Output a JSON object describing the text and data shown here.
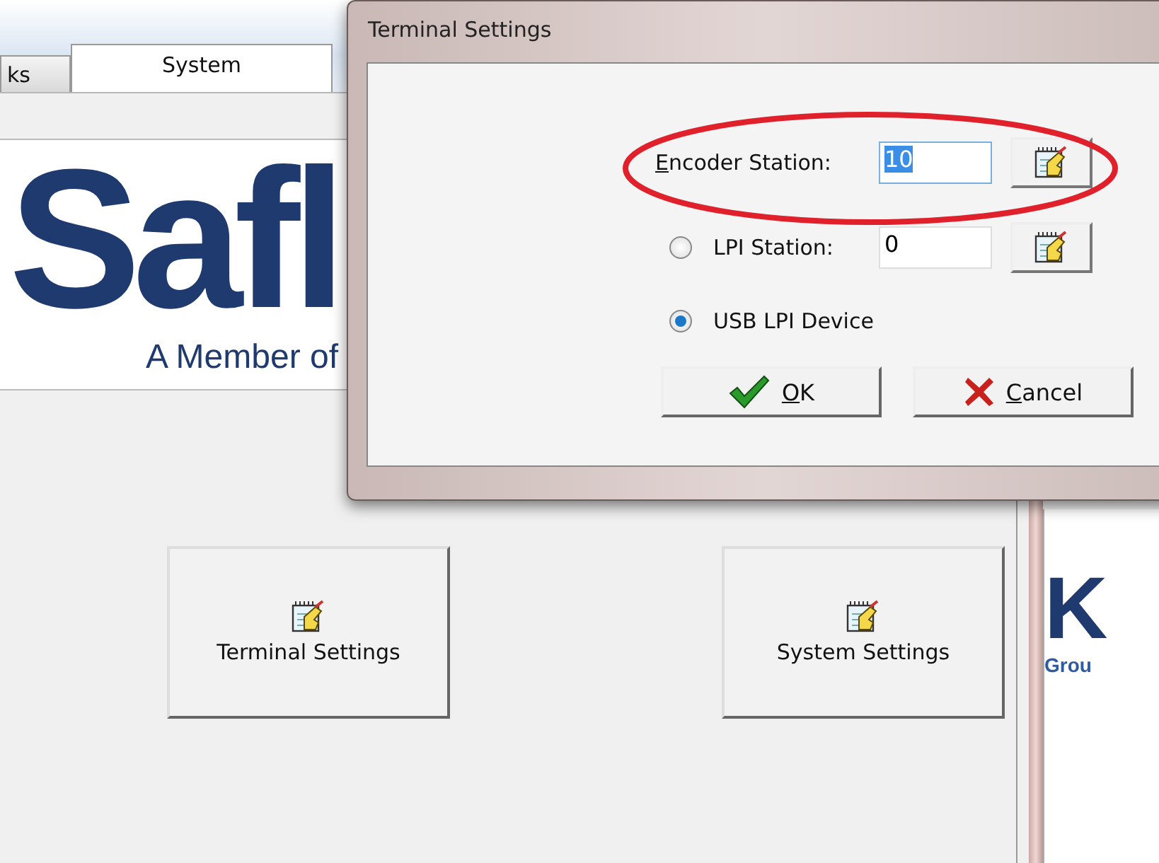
{
  "main_window": {
    "tabs": [
      {
        "label": "ks",
        "selected": false
      },
      {
        "label": "System",
        "selected": true
      }
    ],
    "logo": {
      "wordmark": "Safl",
      "tagline": "A Member of"
    },
    "buttons": [
      {
        "label": "Terminal Settings"
      },
      {
        "label": "System Settings"
      }
    ]
  },
  "back_window": {
    "wordmark": "K",
    "tagline": "Grou"
  },
  "dialog": {
    "title": "Terminal Settings",
    "encoder": {
      "label": "Encoder Station:",
      "value": "10",
      "text_selected": true
    },
    "options": [
      {
        "kind": "radio-field",
        "label": "LPI Station:",
        "value": "0",
        "selected": false
      },
      {
        "kind": "radio",
        "label": "USB LPI Device",
        "selected": true
      }
    ],
    "ok": "OK",
    "cancel": "Cancel"
  }
}
